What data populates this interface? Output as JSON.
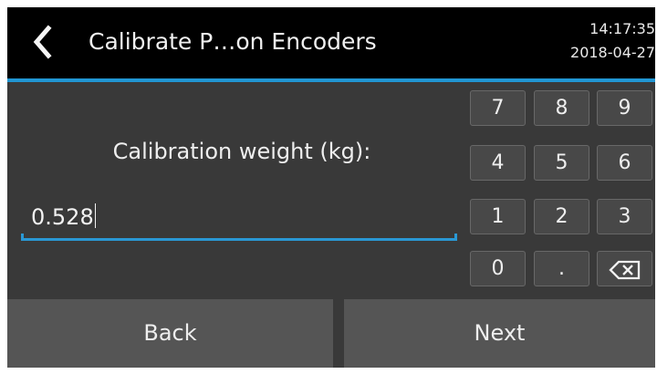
{
  "header": {
    "title": "Calibrate P…on Encoders",
    "time": "14:17:35",
    "date": "2018-04-27",
    "back_icon": "chevron-left-icon",
    "accent_color": "#2196d3"
  },
  "form": {
    "label": "Calibration weight (kg):",
    "value": "0.528"
  },
  "keypad": {
    "keys": [
      "7",
      "8",
      "9",
      "4",
      "5",
      "6",
      "1",
      "2",
      "3",
      "0",
      "."
    ],
    "backspace_icon": "backspace-icon"
  },
  "footer": {
    "back_label": "Back",
    "next_label": "Next"
  }
}
